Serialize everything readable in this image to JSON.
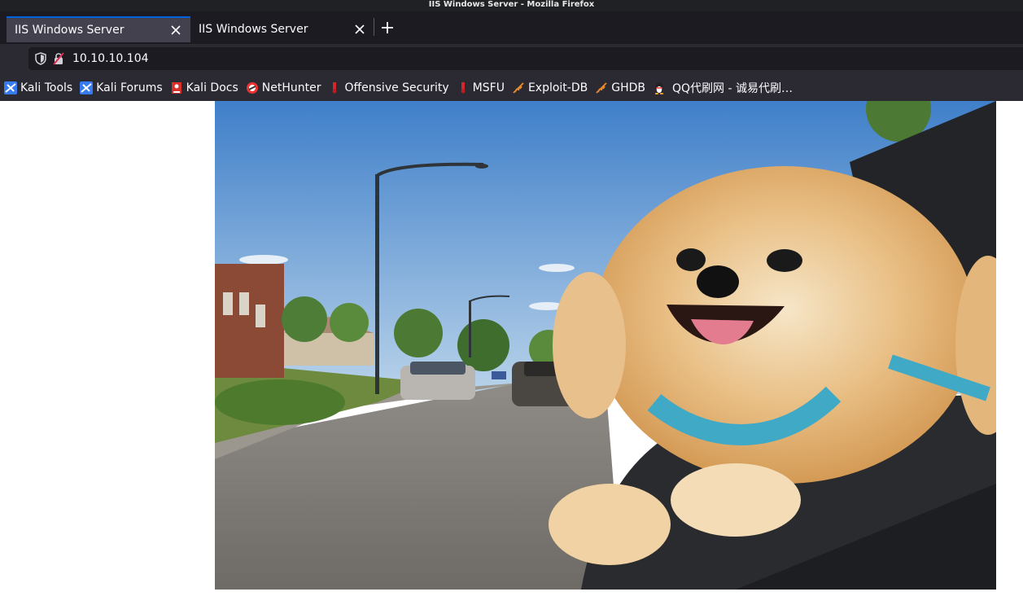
{
  "window": {
    "title": "IIS Windows Server - Mozilla Firefox"
  },
  "tabs": [
    {
      "label": "IIS Windows Server"
    },
    {
      "label": "IIS Windows Server"
    }
  ],
  "urlbar": {
    "value": "10.10.10.104"
  },
  "bookmarks": [
    {
      "label": "Kali Tools",
      "icon": "kali-dragon-icon"
    },
    {
      "label": "Kali Forums",
      "icon": "kali-dragon-icon"
    },
    {
      "label": "Kali Docs",
      "icon": "kali-docs-icon"
    },
    {
      "label": "NetHunter",
      "icon": "nethunter-icon"
    },
    {
      "label": "Offensive Security",
      "icon": "offsec-icon"
    },
    {
      "label": "MSFU",
      "icon": "offsec-icon"
    },
    {
      "label": "Exploit-DB",
      "icon": "exploitdb-icon"
    },
    {
      "label": "GHDB",
      "icon": "exploitdb-icon"
    },
    {
      "label": "QQ代刷网 - 诚易代刷…",
      "icon": "qq-penguin-icon"
    }
  ],
  "colors": {
    "accent": "#0060df",
    "toolbar": "#2b2a33",
    "tabstrip": "#1c1b22"
  }
}
